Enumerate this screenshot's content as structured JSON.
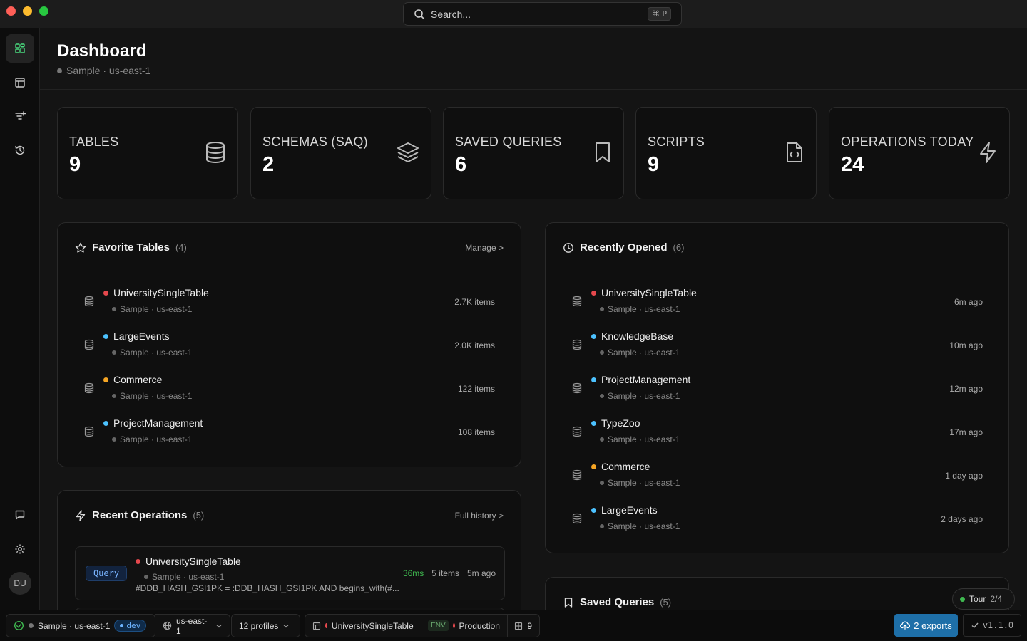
{
  "titlebar": {
    "search_placeholder": "Search...",
    "search_shortcut": "⌘ P"
  },
  "sidebar": {
    "avatar_initials": "DU"
  },
  "header": {
    "title": "Dashboard",
    "connection": "Sample · us-east-1"
  },
  "stats": [
    {
      "label": "TABLES",
      "value": "9",
      "icon": "database-icon"
    },
    {
      "label": "SCHEMAS (SAQ)",
      "value": "2",
      "icon": "layers-icon"
    },
    {
      "label": "SAVED QUERIES",
      "value": "6",
      "icon": "bookmark-icon"
    },
    {
      "label": "SCRIPTS",
      "value": "9",
      "icon": "file-code-icon"
    },
    {
      "label": "OPERATIONS TODAY",
      "value": "24",
      "icon": "lightning-icon"
    }
  ],
  "favorites": {
    "title": "Favorite Tables",
    "count": "(4)",
    "link": "Manage >",
    "items": [
      {
        "name": "UniversitySingleTable",
        "meta": "Sample · us-east-1",
        "right": "2.7K items",
        "color": "#e5484d"
      },
      {
        "name": "LargeEvents",
        "meta": "Sample · us-east-1",
        "right": "2.0K items",
        "color": "#4cc2ff"
      },
      {
        "name": "Commerce",
        "meta": "Sample · us-east-1",
        "right": "122 items",
        "color": "#f5a524"
      },
      {
        "name": "ProjectManagement",
        "meta": "Sample · us-east-1",
        "right": "108 items",
        "color": "#4cc2ff"
      }
    ]
  },
  "recent": {
    "title": "Recently Opened",
    "count": "(6)",
    "items": [
      {
        "name": "UniversitySingleTable",
        "meta": "Sample · us-east-1",
        "right": "6m ago",
        "color": "#e5484d"
      },
      {
        "name": "KnowledgeBase",
        "meta": "Sample · us-east-1",
        "right": "10m ago",
        "color": "#4cc2ff"
      },
      {
        "name": "ProjectManagement",
        "meta": "Sample · us-east-1",
        "right": "12m ago",
        "color": "#4cc2ff"
      },
      {
        "name": "TypeZoo",
        "meta": "Sample · us-east-1",
        "right": "17m ago",
        "color": "#4cc2ff"
      },
      {
        "name": "Commerce",
        "meta": "Sample · us-east-1",
        "right": "1 day ago",
        "color": "#f5a524"
      },
      {
        "name": "LargeEvents",
        "meta": "Sample · us-east-1",
        "right": "2 days ago",
        "color": "#4cc2ff"
      }
    ]
  },
  "operations": {
    "title": "Recent Operations",
    "count": "(5)",
    "link": "Full history >",
    "first": {
      "type": "Query",
      "table": "UniversitySingleTable",
      "meta": "Sample · us-east-1",
      "expression": "#DDB_HASH_GSI1PK = :DDB_HASH_GSI1PK AND begins_with(#...",
      "duration": "36ms",
      "items": "5 items",
      "when": "5m ago"
    }
  },
  "saved": {
    "title": "Saved Queries",
    "count": "(5)"
  },
  "tour": {
    "label": "Tour",
    "step": "2/4"
  },
  "statusbar": {
    "connection": "Sample · us-east-1",
    "env_pill": "dev",
    "region": "us-east-1",
    "profiles": "12 profiles",
    "table": "UniversitySingleTable",
    "env_tag": "ENV",
    "environment": "Production",
    "table_count": "9",
    "exports": "2 exports",
    "version": "v1.1.0"
  },
  "colors": {
    "accent": "#1e6fa8",
    "green": "#3fb950",
    "red": "#e5484d",
    "blue": "#4cc2ff",
    "orange": "#f5a524"
  }
}
